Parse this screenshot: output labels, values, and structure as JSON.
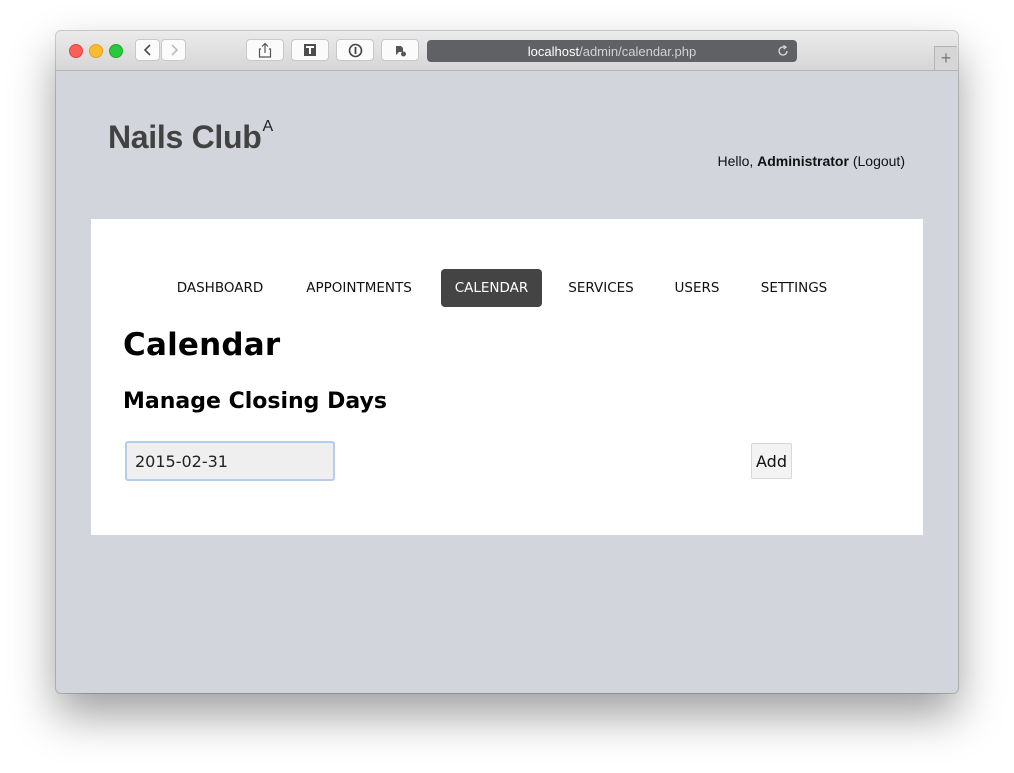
{
  "browser": {
    "address_host": "localhost",
    "address_path": "/admin/calendar.php",
    "new_tab_symbol": "+"
  },
  "site": {
    "logo_text": "Nails Club",
    "logo_sup": "A"
  },
  "user": {
    "greeting": "Hello, ",
    "name": "Administrator",
    "logout_open": " (",
    "logout_label": "Logout",
    "logout_close": ")"
  },
  "nav": {
    "items": [
      {
        "label": "DASHBOARD"
      },
      {
        "label": "APPOINTMENTS"
      },
      {
        "label": "CALENDAR",
        "active": true
      },
      {
        "label": "SERVICES"
      },
      {
        "label": "USERS"
      },
      {
        "label": "SETTINGS"
      }
    ]
  },
  "main": {
    "title": "Calendar",
    "section_title": "Manage Closing Days",
    "date_input_value": "2015-02-31",
    "add_button_label": "Add"
  },
  "colors": {
    "page_background": "#d2d5dc",
    "active_nav": "#444444",
    "input_focus_border": "#b7ccec"
  },
  "icons": [
    "back-icon",
    "forward-icon",
    "share-icon",
    "reader-icon",
    "password-icon",
    "extension-icon",
    "reload-icon"
  ]
}
